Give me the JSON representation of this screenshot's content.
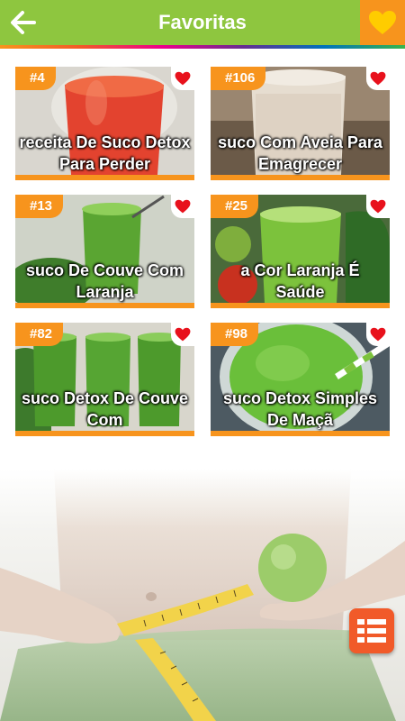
{
  "header": {
    "title": "Favoritas",
    "back_icon": "arrow-left-icon",
    "favorites_icon": "heart-icon",
    "color": "#8ec63f",
    "accent": "#f7941d"
  },
  "favorites": [
    {
      "number": "#4",
      "title": "receita De Suco Detox Para Perder",
      "favorited": true
    },
    {
      "number": "#106",
      "title": "suco Com Aveia Para Emagrecer",
      "favorited": true
    },
    {
      "number": "#13",
      "title": "suco De Couve Com Laranja",
      "favorited": true
    },
    {
      "number": "#25",
      "title": "a Cor Laranja É Saúde",
      "favorited": true
    },
    {
      "number": "#82",
      "title": "suco Detox De Couve Com",
      "favorited": true
    },
    {
      "number": "#98",
      "title": "suco Detox Simples De Maçã",
      "favorited": true
    }
  ],
  "fab": {
    "icon": "list-menu-icon",
    "color": "#f15a29"
  }
}
